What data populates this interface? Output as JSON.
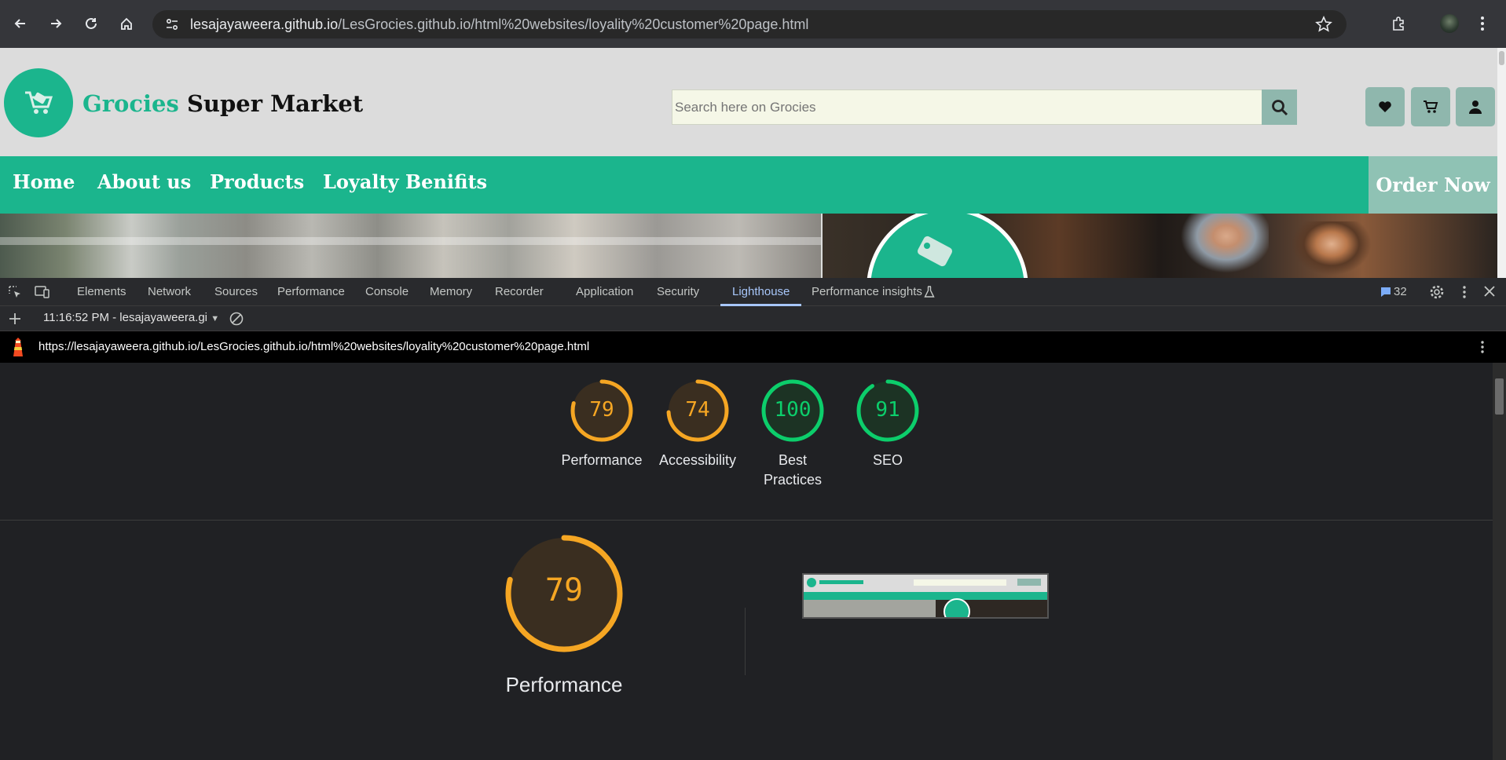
{
  "browser": {
    "url_host": "lesajayaweera.github.io",
    "url_path": "/LesGrocies.github.io/html%20websites/loyality%20customer%20page.html"
  },
  "site": {
    "brand_green": "Grocies",
    "brand_dark": "Super Market",
    "search_placeholder": "Search here on Grocies",
    "nav": [
      "Home",
      "About us",
      "Products",
      "Loyalty Benifits"
    ],
    "order_now": "Order Now",
    "colors": {
      "primary": "#1bb58d",
      "muted": "#8fb7ad"
    }
  },
  "devtools": {
    "tabs": [
      "Elements",
      "Network",
      "Sources",
      "Performance",
      "Console",
      "Memory",
      "Recorder",
      "Application",
      "Security",
      "Lighthouse",
      "Performance insights"
    ],
    "active_tab": "Lighthouse",
    "issues_count": "32",
    "report_select": "11:16:52 PM - lesajayaweera.gi",
    "report_url": "https://lesajayaweera.github.io/LesGrocies.github.io/html%20websites/loyality%20customer%20page.html"
  },
  "lighthouse": {
    "scores": [
      {
        "label": "Performance",
        "value": "79",
        "fraction": 0.79,
        "color": "#f5a623"
      },
      {
        "label": "Accessibility",
        "value": "74",
        "fraction": 0.74,
        "color": "#f5a623"
      },
      {
        "label": "Best Practices",
        "value": "100",
        "fraction": 1.0,
        "color": "#0cce6b"
      },
      {
        "label": "SEO",
        "value": "91",
        "fraction": 0.91,
        "color": "#0cce6b"
      }
    ],
    "main_score": {
      "label": "Performance",
      "value": "79",
      "fraction": 0.79,
      "color": "#f5a623"
    }
  }
}
